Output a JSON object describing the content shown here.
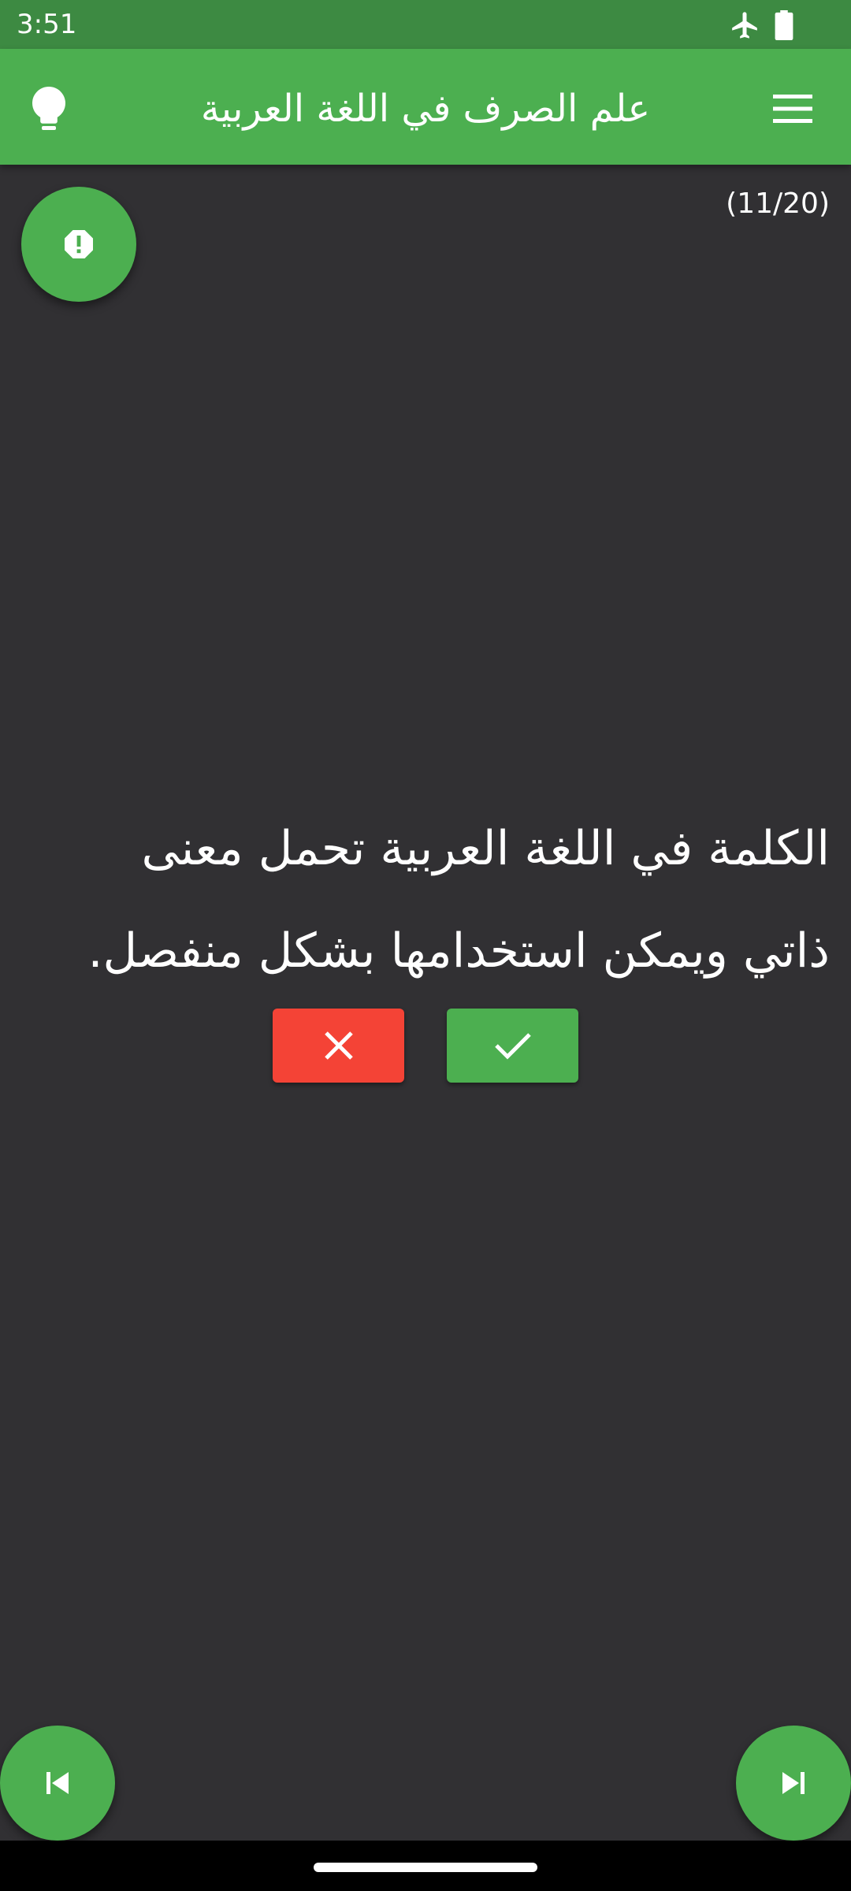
{
  "status_bar": {
    "time": "3:51",
    "icons": [
      "airplane-mode-icon",
      "battery-full-icon"
    ]
  },
  "app_bar": {
    "title": "علم الصرف في اللغة العربية",
    "left_icon": "lightbulb-icon",
    "right_icon": "menu-icon",
    "color": "#4caf50"
  },
  "quiz": {
    "counter": "(11/20)",
    "question": "الكلمة في اللغة العربية تحمل معنى ذاتي ويمكن استخدامها بشكل منفصل.",
    "report_icon": "report-icon"
  },
  "answers": {
    "wrong_icon": "close-icon",
    "wrong_color": "#f44336",
    "right_icon": "check-icon",
    "right_color": "#4caf50"
  },
  "navigation": {
    "prev_icon": "skip-previous-icon",
    "next_icon": "skip-next-icon"
  },
  "colors": {
    "background": "#313033",
    "status_bar": "#3d8a42",
    "accent": "#4caf50"
  }
}
